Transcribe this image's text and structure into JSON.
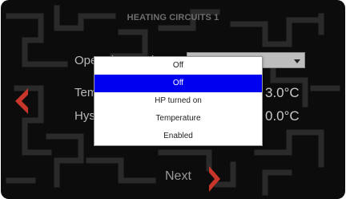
{
  "screen": {
    "title": "HEATING CIRCUITS 1"
  },
  "fields": {
    "operation_label": "Operation mode",
    "operation_value": "Off",
    "temperature_label": "Temperature",
    "temperature_value": "3.0°C",
    "hysteresis_label": "Hysteresis",
    "hysteresis_value": "0.0°C"
  },
  "dropdown": {
    "options": [
      "Off",
      "Off",
      "HP turned on",
      "Temperature",
      "Enabled"
    ],
    "selected_index": 1
  },
  "nav": {
    "next_label": "Next",
    "prev_icon": "chevron-left-icon",
    "next_icon": "chevron-right-icon"
  },
  "colors": {
    "accent_red": "#c8352a",
    "selection_blue": "#0000f0",
    "background": "#0c0c0c"
  }
}
